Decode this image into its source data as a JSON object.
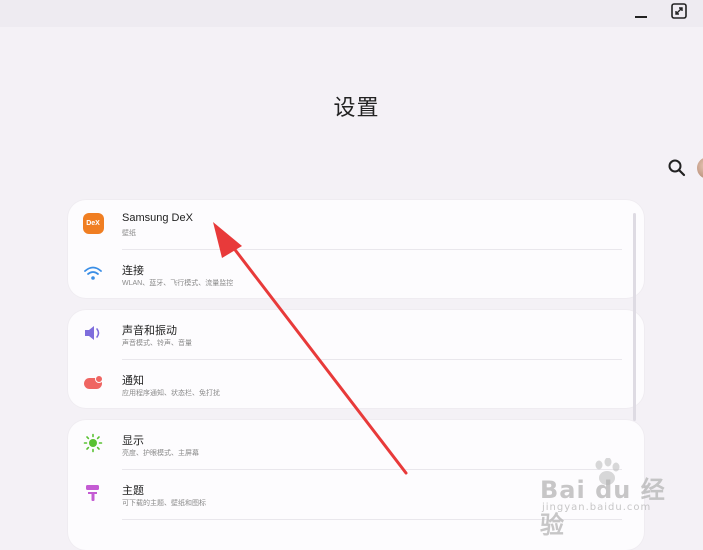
{
  "window": {
    "controls": {
      "minimize_icon": "minimize-icon",
      "maximize_icon": "expand-icon"
    }
  },
  "page": {
    "title": "设置"
  },
  "header": {
    "search_icon": "search-icon"
  },
  "settings": [
    {
      "title": "Samsung DeX",
      "subtitle": "壁纸",
      "icon": "dex-icon",
      "icon_label": "DeX",
      "color": "#f07e22"
    },
    {
      "title": "连接",
      "subtitle": "WLAN、蓝牙、飞行模式、流量监控",
      "icon": "wifi-icon",
      "color": "#3a8ee6"
    },
    {
      "title": "声音和振动",
      "subtitle": "声音模式、铃声、音量",
      "icon": "volume-icon",
      "color": "#7e6ddc"
    },
    {
      "title": "通知",
      "subtitle": "应用程序通知、状态栏、免打扰",
      "icon": "notification-icon",
      "color": "#ef6562"
    },
    {
      "title": "显示",
      "subtitle": "亮度、护眼模式、主屏幕",
      "icon": "sun-icon",
      "color": "#59c132"
    },
    {
      "title": "主题",
      "subtitle": "可下载的主题、壁纸和图标",
      "icon": "paint-roller-icon",
      "color": "#c45bd3"
    }
  ],
  "overlay": {
    "arrow_color": "#e83a3a"
  },
  "watermark": {
    "logo": "Bai du 经验",
    "url": "jingyan.baidu.com"
  }
}
